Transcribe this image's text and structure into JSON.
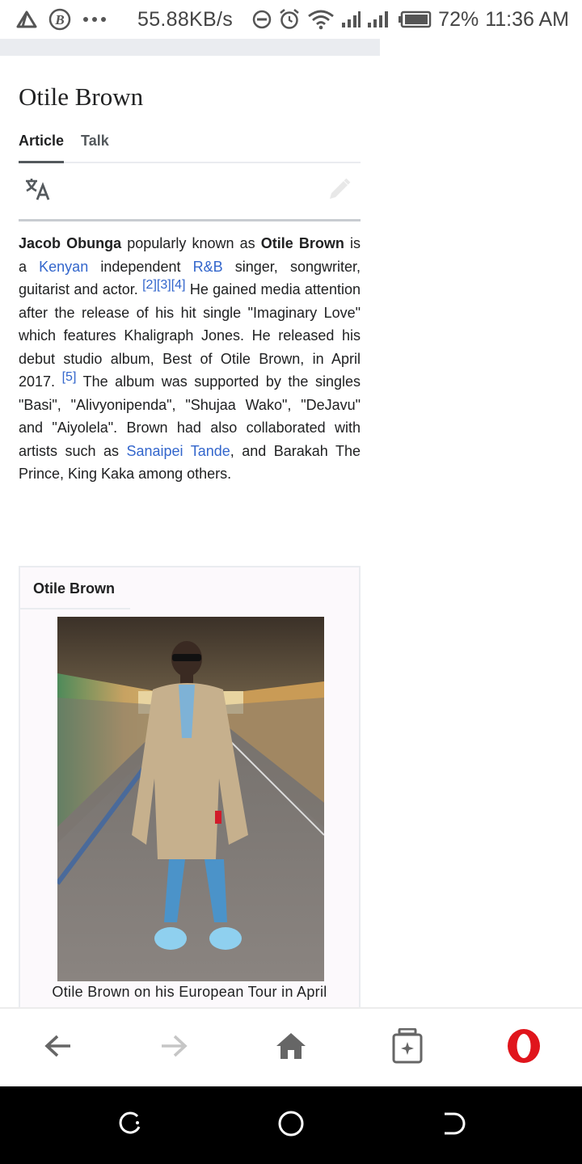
{
  "status_bar": {
    "speed": "55.88KB/s",
    "battery": "72%",
    "time": "11:36 AM",
    "icons": [
      "alert-triangle-icon",
      "b-circle-icon",
      "more-dots-icon",
      "dnd-icon",
      "alarm-icon",
      "wifi-icon",
      "signal-icon",
      "signal-icon",
      "battery-icon"
    ]
  },
  "article": {
    "title": "Otile Brown",
    "tabs": [
      {
        "label": "Article",
        "active": true
      },
      {
        "label": "Talk",
        "active": false
      }
    ],
    "actions": {
      "language_icon": "translate-icon",
      "edit_icon": "pencil-icon"
    },
    "paragraph": {
      "s1_bold1": "Jacob Obunga",
      "s1_t1": " popularly known as ",
      "s1_bold2": "Otile Brown",
      "s1_t2": " is a ",
      "link_kenyan": "Kenyan",
      "s1_t3": " independent ",
      "link_rnb": "R&B",
      "s1_t4": " singer, songwriter, guitarist and actor.",
      "ref1": "[2][3][4]",
      "s2": " He gained media attention after the release of his hit single \"Imaginary Love\" which features Khaligraph Jones. He released his debut studio album, Best of Otile Brown, in April 2017.",
      "ref2": "[5]",
      "s3": " The album was supported by the singles \"Basi\", \"Alivyonipenda\",  \"Shujaa Wako\", \"DeJavu\"  and \"Aiyolela\".  Brown had also collaborated with artists such as ",
      "link_sanaipei": "Sanaipei Tande",
      "s4": ", and Barakah The Prince, King Kaka among others."
    },
    "infobox": {
      "title": "Otile Brown",
      "caption": "Otile Brown  on his European  Tour in April"
    }
  },
  "browser_bar": {
    "icons": [
      "back-arrow-icon",
      "forward-arrow-icon",
      "home-icon",
      "tabs-icon",
      "opera-logo-icon"
    ],
    "colors": {
      "opera": "#e0151c",
      "disabled": "#c6c6c6",
      "enabled": "#666666"
    }
  },
  "nav_bar": {
    "icons": [
      "recents-icon",
      "home-circle-icon",
      "back-icon"
    ]
  }
}
